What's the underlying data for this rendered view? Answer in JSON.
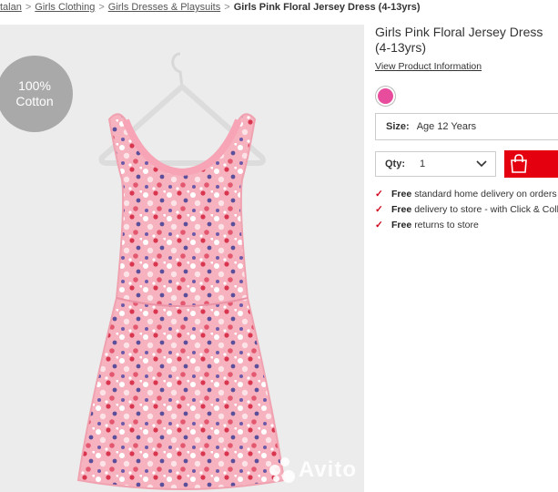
{
  "breadcrumb": {
    "items": [
      "talan",
      "Girls Clothing",
      "Girls Dresses & Playsuits"
    ],
    "current": "Girls Pink Floral Jersey Dress (4-13yrs)"
  },
  "product_image": {
    "badge_line1": "100%",
    "badge_line2": "Cotton",
    "watermark": "Avito",
    "dress_color": "#f4a9b6",
    "background_color": "#ececec"
  },
  "product": {
    "title": "Girls Pink Floral Jersey Dress (4-13yrs)",
    "view_link": "View Product Information",
    "swatch_color": "#e84c9c"
  },
  "size": {
    "label": "Size:",
    "value": "Age 12 Years"
  },
  "quantity": {
    "label": "Qty:",
    "value": "1"
  },
  "cart": {
    "icon": "shopping-bag-icon",
    "color": "#e4000f"
  },
  "benefits": [
    {
      "bold": "Free",
      "text": "standard home delivery on orders"
    },
    {
      "bold": "Free",
      "text": "delivery to store - with Click & Colle"
    },
    {
      "bold": "Free",
      "text": "returns to store"
    }
  ]
}
